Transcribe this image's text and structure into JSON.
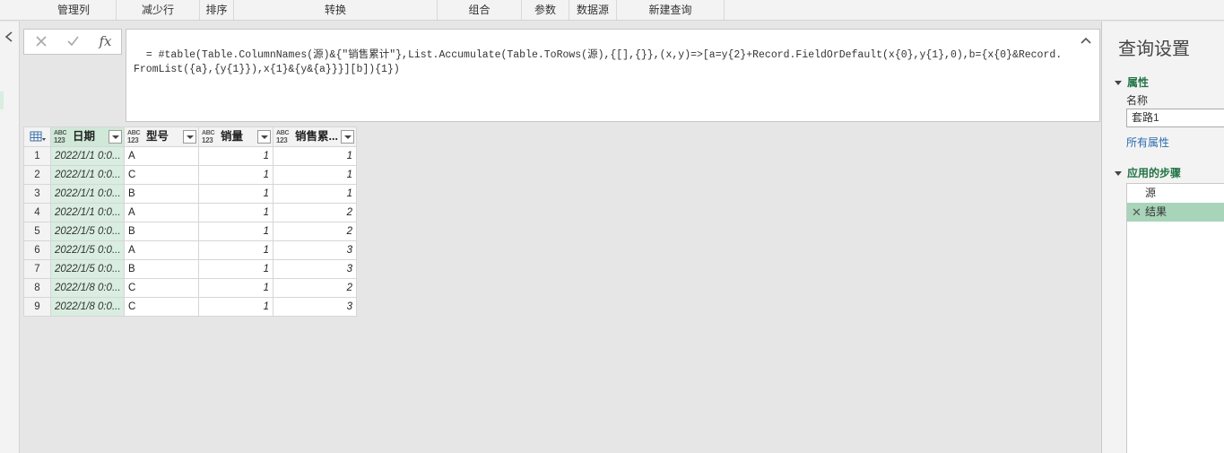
{
  "ribbon": {
    "groups": [
      "管理列",
      "减少行",
      "排序",
      "转换",
      "组合",
      "参数",
      "数据源",
      "新建查询"
    ]
  },
  "formula_bar": {
    "cancel_icon": "close-icon",
    "commit_icon": "check-icon",
    "fx_label": "fx",
    "formula": "= #table(Table.ColumnNames(源)&{\"销售累计\"},List.Accumulate(Table.ToRows(源),{[],{}},(x,y)=>[a=y{2}+Record.FieldOrDefault(x{0},y{1},0),b={x{0}&Record.FromList({a},{y{1}}),x{1}&{y&{a}}}][b]){1})"
  },
  "table": {
    "columns": [
      {
        "type_top": "ABC",
        "type_bottom": "123",
        "name": "日期"
      },
      {
        "type_top": "ABC",
        "type_bottom": "123",
        "name": "型号"
      },
      {
        "type_top": "ABC",
        "type_bottom": "123",
        "name": "销量"
      },
      {
        "type_top": "ABC",
        "type_bottom": "123",
        "name": "销售累..."
      }
    ],
    "rows": [
      {
        "n": "1",
        "date": "2022/1/1 0:0...",
        "model": "A",
        "qty": "1",
        "cum": "1"
      },
      {
        "n": "2",
        "date": "2022/1/1 0:0...",
        "model": "C",
        "qty": "1",
        "cum": "1"
      },
      {
        "n": "3",
        "date": "2022/1/1 0:0...",
        "model": "B",
        "qty": "1",
        "cum": "1"
      },
      {
        "n": "4",
        "date": "2022/1/1 0:0...",
        "model": "A",
        "qty": "1",
        "cum": "2"
      },
      {
        "n": "5",
        "date": "2022/1/5 0:0...",
        "model": "B",
        "qty": "1",
        "cum": "2"
      },
      {
        "n": "6",
        "date": "2022/1/5 0:0...",
        "model": "A",
        "qty": "1",
        "cum": "3"
      },
      {
        "n": "7",
        "date": "2022/1/5 0:0...",
        "model": "B",
        "qty": "1",
        "cum": "3"
      },
      {
        "n": "8",
        "date": "2022/1/8 0:0...",
        "model": "C",
        "qty": "1",
        "cum": "2"
      },
      {
        "n": "9",
        "date": "2022/1/8 0:0...",
        "model": "C",
        "qty": "1",
        "cum": "3"
      }
    ]
  },
  "query_settings": {
    "title": "查询设置",
    "properties_header": "属性",
    "name_label": "名称",
    "name_value": "套路1",
    "all_properties_link": "所有属性",
    "steps_header": "应用的步骤",
    "steps": [
      {
        "label": "源",
        "active": false
      },
      {
        "label": "结果",
        "active": true
      }
    ]
  },
  "colors": {
    "accent_green": "#217346",
    "selected_column": "#d9ede0",
    "active_step": "#a8d4b9"
  }
}
